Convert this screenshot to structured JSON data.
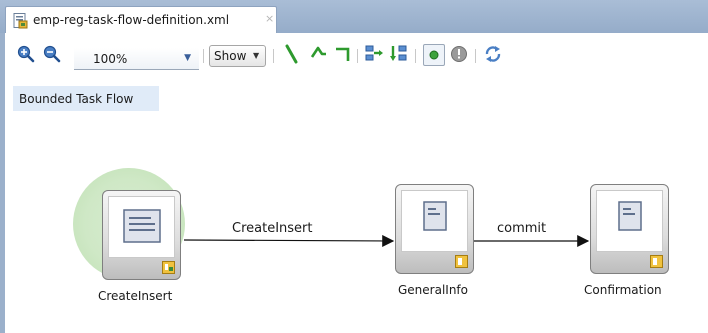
{
  "editor": {
    "tab_title": "emp-reg-task-flow-definition.xml",
    "tab_close": "×"
  },
  "toolbar": {
    "zoom_value": "100%",
    "show_label": "Show",
    "icons": [
      "zoom-in-icon",
      "zoom-out-icon",
      "straight-connector-icon",
      "curved-connector-icon",
      "orthogonal-connector-icon",
      "layout-horizontal-icon",
      "layout-vertical-icon",
      "default-activity-icon",
      "exception-handler-icon",
      "refresh-icon"
    ]
  },
  "diagram": {
    "flow_type_label": "Bounded Task Flow",
    "nodes": [
      {
        "id": "createinsert",
        "label": "CreateInsert",
        "default_activity": true
      },
      {
        "id": "generalinfo",
        "label": "GeneralInfo",
        "default_activity": false
      },
      {
        "id": "confirmation",
        "label": "Confirmation",
        "default_activity": false
      }
    ],
    "edges": [
      {
        "from": "createinsert",
        "to": "generalinfo",
        "label": "CreateInsert"
      },
      {
        "from": "generalinfo",
        "to": "confirmation",
        "label": "commit"
      }
    ]
  },
  "colors": {
    "tabbar": "#a9bdd6",
    "flow_label_bg": "#e0ebf8",
    "default_activity_glow": "#cfe8c6",
    "connector_green": "#2e9a2e"
  }
}
